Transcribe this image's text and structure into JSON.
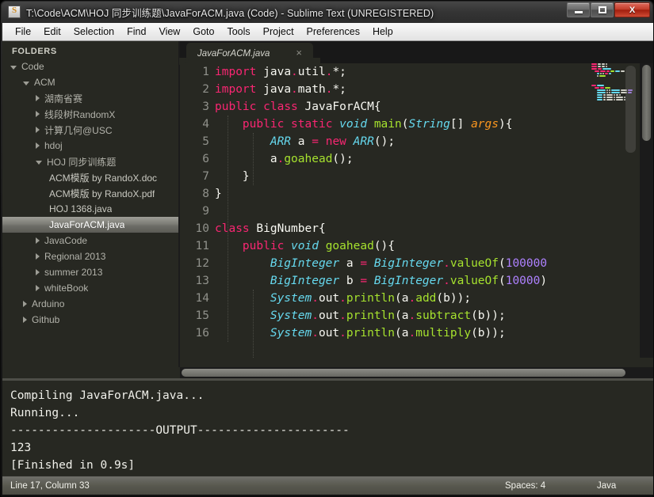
{
  "window": {
    "title": "T:\\Code\\ACM\\HOJ 同步训练题\\JavaForACM.java (Code) - Sublime Text (UNREGISTERED)",
    "app_icon": "sublime-text-icon",
    "minimize_label": "–",
    "maximize_label": "□",
    "close_label": "X"
  },
  "menubar": {
    "items": [
      {
        "label": "File"
      },
      {
        "label": "Edit"
      },
      {
        "label": "Selection"
      },
      {
        "label": "Find"
      },
      {
        "label": "View"
      },
      {
        "label": "Goto"
      },
      {
        "label": "Tools"
      },
      {
        "label": "Project"
      },
      {
        "label": "Preferences"
      },
      {
        "label": "Help"
      }
    ]
  },
  "sidebar": {
    "header": "FOLDERS",
    "items": [
      {
        "label": "Code",
        "depth": 0,
        "state": "open",
        "type": "folder"
      },
      {
        "label": "ACM",
        "depth": 1,
        "state": "open",
        "type": "folder"
      },
      {
        "label": "湖南省赛",
        "depth": 2,
        "state": "closed",
        "type": "folder"
      },
      {
        "label": "线段树RandomX",
        "depth": 2,
        "state": "closed",
        "type": "folder"
      },
      {
        "label": "计算几何@USC",
        "depth": 2,
        "state": "closed",
        "type": "folder"
      },
      {
        "label": "hdoj",
        "depth": 2,
        "state": "closed",
        "type": "folder"
      },
      {
        "label": "HOJ 同步训练题",
        "depth": 2,
        "state": "open",
        "type": "folder"
      },
      {
        "label": "ACM模版 by RandoX.doc",
        "depth": 3,
        "state": "none",
        "type": "file"
      },
      {
        "label": "ACM模版 by RandoX.pdf",
        "depth": 3,
        "state": "none",
        "type": "file"
      },
      {
        "label": "HOJ 1368.java",
        "depth": 3,
        "state": "none",
        "type": "file"
      },
      {
        "label": "JavaForACM.java",
        "depth": 3,
        "state": "none",
        "type": "file",
        "selected": true
      },
      {
        "label": "JavaCode",
        "depth": 2,
        "state": "closed",
        "type": "folder"
      },
      {
        "label": "Regional 2013",
        "depth": 2,
        "state": "closed",
        "type": "folder"
      },
      {
        "label": "summer 2013",
        "depth": 2,
        "state": "closed",
        "type": "folder"
      },
      {
        "label": "whiteBook",
        "depth": 2,
        "state": "closed",
        "type": "folder"
      },
      {
        "label": "Arduino",
        "depth": 1,
        "state": "closed",
        "type": "folder"
      },
      {
        "label": "Github",
        "depth": 1,
        "state": "closed",
        "type": "folder"
      }
    ]
  },
  "editor": {
    "tab": {
      "label": "JavaForACM.java",
      "close_glyph": "×"
    },
    "line_numbers": [
      1,
      2,
      3,
      4,
      5,
      6,
      7,
      8,
      9,
      10,
      11,
      12,
      13,
      14,
      15,
      16
    ],
    "lines": [
      {
        "n": 1,
        "text": "import java.util.*;"
      },
      {
        "n": 2,
        "text": "import java.math.*;"
      },
      {
        "n": 3,
        "text": "public class JavaForACM{"
      },
      {
        "n": 4,
        "text": "    public static void main(String[] args){"
      },
      {
        "n": 5,
        "text": "        ARR a = new ARR();"
      },
      {
        "n": 6,
        "text": "        a.goahead();"
      },
      {
        "n": 7,
        "text": "    }"
      },
      {
        "n": 8,
        "text": "}"
      },
      {
        "n": 9,
        "text": ""
      },
      {
        "n": 10,
        "text": "class BigNumber{"
      },
      {
        "n": 11,
        "text": "    public void goahead(){"
      },
      {
        "n": 12,
        "text": "        BigInteger a = BigInteger.valueOf(100000"
      },
      {
        "n": 13,
        "text": "        BigInteger b = BigInteger.valueOf(10000)"
      },
      {
        "n": 14,
        "text": "        System.out.println(a.add(b));"
      },
      {
        "n": 15,
        "text": "        System.out.println(a.subtract(b));"
      },
      {
        "n": 16,
        "text": "        System.out.println(a.multiply(b));"
      }
    ]
  },
  "console": {
    "lines": [
      "Compiling JavaForACM.java...",
      "Running...",
      "---------------------OUTPUT----------------------",
      "123",
      "[Finished in 0.9s]"
    ]
  },
  "statusbar": {
    "position": "Line 17, Column 33",
    "indentation": "Spaces: 4",
    "syntax": "Java"
  },
  "colors": {
    "editor_bg": "#272822",
    "keyword": "#f92672",
    "type": "#66d9ef",
    "function": "#a6e22e",
    "number": "#ae81ff",
    "variable": "#fd971f",
    "foreground": "#f8f8f2",
    "close_button": "#c23b28"
  }
}
